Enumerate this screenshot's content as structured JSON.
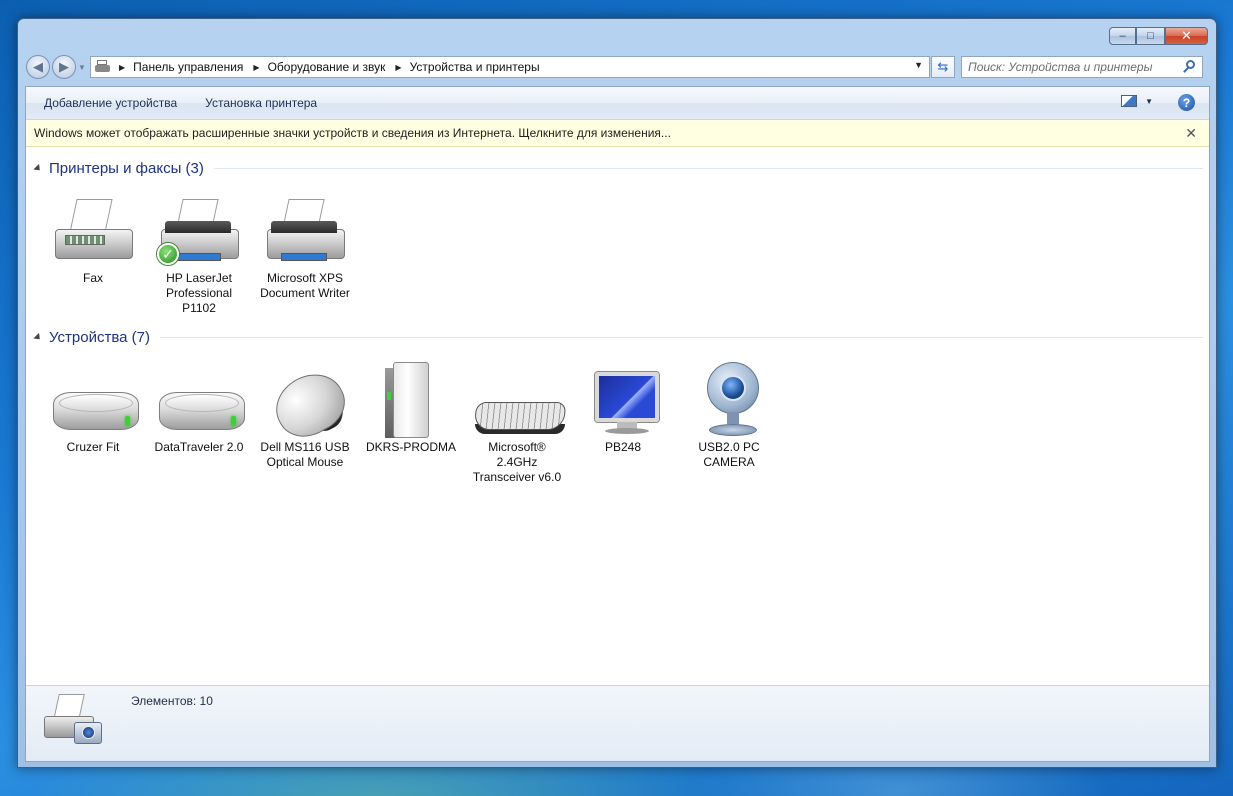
{
  "window": {
    "caption_buttons": {
      "minimize": "–",
      "maximize": "□",
      "close": "✕"
    }
  },
  "nav": {
    "back_glyph": "◀",
    "forward_glyph": "▶",
    "address": {
      "icon": "devices-printers-icon",
      "breadcrumbs": [
        "Панель управления",
        "Оборудование и звук",
        "Устройства и принтеры"
      ],
      "separator": "▶"
    },
    "search": {
      "placeholder": "Поиск: Устройства и принтеры"
    }
  },
  "commandbar": {
    "add_device": "Добавление устройства",
    "add_printer": "Установка принтера",
    "help_glyph": "?"
  },
  "infobar": {
    "text": "Windows может отображать расширенные значки устройств и сведения из Интернета.  Щелкните для изменения...",
    "close_glyph": "✕"
  },
  "sections": [
    {
      "title": "Принтеры и факсы (3)",
      "items": [
        {
          "label": "Fax",
          "icon": "fax-icon"
        },
        {
          "label": "HP LaserJet Professional P1102",
          "icon": "printer-default-icon"
        },
        {
          "label": "Microsoft XPS Document Writer",
          "icon": "printer-icon"
        }
      ]
    },
    {
      "title": "Устройства (7)",
      "items": [
        {
          "label": "Cruzer Fit",
          "icon": "usb-drive-icon"
        },
        {
          "label": "DataTraveler 2.0",
          "icon": "usb-drive-icon"
        },
        {
          "label": "Dell MS116 USB Optical Mouse",
          "icon": "mouse-icon"
        },
        {
          "label": "DKRS-PRODMA",
          "icon": "computer-tower-icon"
        },
        {
          "label": "Microsoft® 2.4GHz Transceiver v6.0",
          "icon": "keyboard-icon"
        },
        {
          "label": "PB248",
          "icon": "monitor-icon"
        },
        {
          "label": "USB2.0 PC CAMERA",
          "icon": "webcam-icon"
        }
      ]
    }
  ],
  "status": {
    "text": "Элементов: 10",
    "icon": "devices-printers-icon"
  },
  "colors": {
    "section_title": "#1e3287",
    "infobar_bg": "#ffffe1",
    "window_frame": "#b6d2f0"
  }
}
